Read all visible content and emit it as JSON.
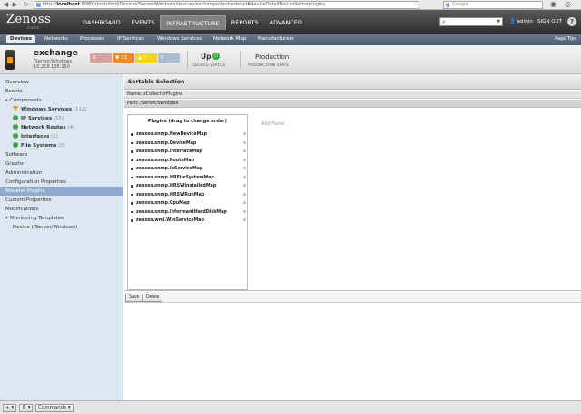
{
  "browser": {
    "url_prefix": "http://",
    "url_host": "localhost",
    "url_rest": ":8080/zport/dmd/Devices/Server/Windows/devices/exchange/devicedetail#deviceDetailNav:collectorplugins",
    "search_engine": "Google"
  },
  "app": {
    "logo": "Zenoss",
    "logo_sub": "CORE",
    "nav": [
      "DASHBOARD",
      "EVENTS",
      "INFRASTRUCTURE",
      "REPORTS",
      "ADVANCED"
    ],
    "active_nav": "INFRASTRUCTURE",
    "user": "admin",
    "signout": "SIGN OUT",
    "help": "?"
  },
  "subnav": {
    "items": [
      "Devices",
      "Networks",
      "Processes",
      "IP Services",
      "Windows Services",
      "Network Map",
      "Manufacturers"
    ],
    "page_tips": "Page Tips"
  },
  "device": {
    "name": "exchange",
    "class": "/Server/Windows",
    "ip": "10.218.138.250",
    "events": {
      "critical": "0",
      "error": "21",
      "warning": "7",
      "info": "0"
    },
    "status_value": "Up",
    "status_label": "DEVICE STATUS",
    "production_value": "Production",
    "production_label": "PRODUCTION STATE"
  },
  "sidebar": {
    "items": [
      {
        "label": "Overview"
      },
      {
        "label": "Events"
      },
      {
        "label": "Components"
      },
      {
        "label": "Windows Services",
        "count": "(112)"
      },
      {
        "label": "IP Services",
        "count": "(15)"
      },
      {
        "label": "Network Routes",
        "count": "(4)"
      },
      {
        "label": "Interfaces",
        "count": "(2)"
      },
      {
        "label": "File Systems",
        "count": "(3)"
      },
      {
        "label": "Software"
      },
      {
        "label": "Graphs"
      },
      {
        "label": "Administration"
      },
      {
        "label": "Configuration Properties"
      },
      {
        "label": "Modeler Plugins"
      },
      {
        "label": "Custom Properties"
      },
      {
        "label": "Modifications"
      },
      {
        "label": "Monitoring Templates"
      },
      {
        "label": "Device (/Server/Windows)"
      }
    ]
  },
  "panel": {
    "title": "Sortable Selection",
    "name": "Name: zCollectorPlugins",
    "path": "Path: /Server/Windows",
    "list_header": "Plugins (drag to change order)",
    "add_fields": "Add Fields",
    "plugins": [
      "zenoss.snmp.NewDeviceMap",
      "zenoss.snmp.DeviceMap",
      "zenoss.snmp.InterfaceMap",
      "zenoss.snmp.RouteMap",
      "zenoss.snmp.IpServiceMap",
      "zenoss.snmp.HRFileSystemMap",
      "zenoss.snmp.HRSWInstalledMap",
      "zenoss.snmp.HRSWRunMap",
      "zenoss.snmp.CpuMap",
      "zenoss.snmp.InformantHardDiskMap",
      "zenoss.wmi.WinServiceMap"
    ],
    "remove_glyph": "x",
    "save_label": "Save",
    "delete_label": "Delete"
  },
  "bottom": {
    "add": "+",
    "gear": "⚙",
    "commands": "Commands"
  }
}
